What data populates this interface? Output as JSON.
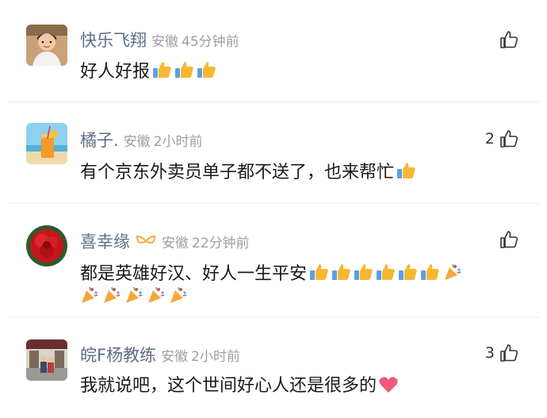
{
  "comments": [
    {
      "username": "快乐飞翔",
      "location": "安徽",
      "time": "45分钟前",
      "text": "好人好报",
      "likes": "",
      "badge": false,
      "avatar_icon": "woman-portrait-avatar",
      "thumb_emojis": 3,
      "party_emojis": 0,
      "heart_emoji": false
    },
    {
      "username": "橘子.",
      "location": "安徽",
      "time": "2小时前",
      "text": "有个京东外卖员单子都不送了，也来帮忙",
      "likes": "2",
      "badge": false,
      "avatar_icon": "orange-juice-beach-avatar",
      "thumb_emojis": 1,
      "party_emojis": 0,
      "heart_emoji": false
    },
    {
      "username": "喜幸缘",
      "location": "安徽",
      "time": "22分钟前",
      "text": "都是英雄好汉、好人一生平安",
      "likes": "",
      "badge": true,
      "avatar_icon": "red-flower-avatar",
      "thumb_emojis": 6,
      "party_emojis": 6,
      "heart_emoji": false
    },
    {
      "username": "皖F杨教练",
      "location": "安徽",
      "time": "2小时前",
      "text": "我就说吧，这个世间好心人还是很多的",
      "likes": "3",
      "badge": false,
      "avatar_icon": "storefront-people-avatar",
      "thumb_emojis": 0,
      "party_emojis": 0,
      "heart_emoji": true
    }
  ],
  "colors": {
    "username": "#5f6f86",
    "meta": "#9e9e9e",
    "text": "#1a1a1a",
    "badge": "#f2b24a",
    "thumb": "#f7b733",
    "heart": "#ef5a7a"
  }
}
